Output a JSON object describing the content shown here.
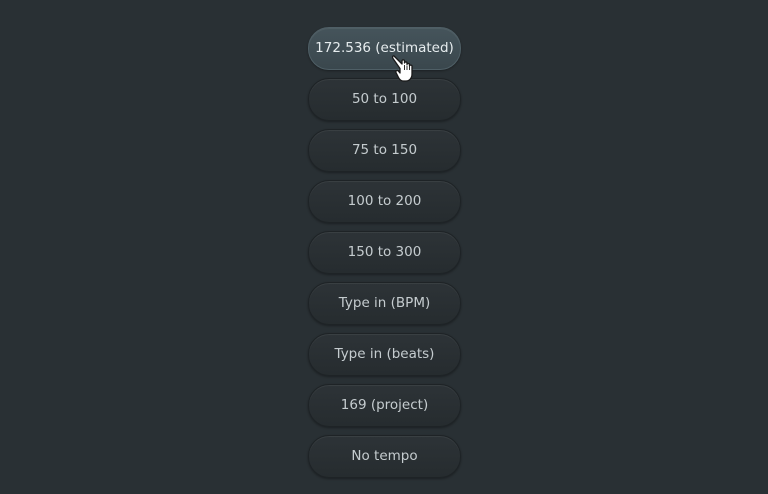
{
  "tempo_menu": {
    "options": [
      {
        "label": "172.536 (estimated)"
      },
      {
        "label": "50 to 100"
      },
      {
        "label": "75 to 150"
      },
      {
        "label": "100 to 200"
      },
      {
        "label": "150 to 300"
      },
      {
        "label": "Type in (BPM)"
      },
      {
        "label": "Type in (beats)"
      },
      {
        "label": "169 (project)"
      },
      {
        "label": "No tempo"
      }
    ],
    "hovered_option": "172.536 (estimated)"
  },
  "colors": {
    "background": "#293034",
    "button": "#2a3034",
    "button_hover": "#3f4d53",
    "text": "#c5cccf"
  }
}
